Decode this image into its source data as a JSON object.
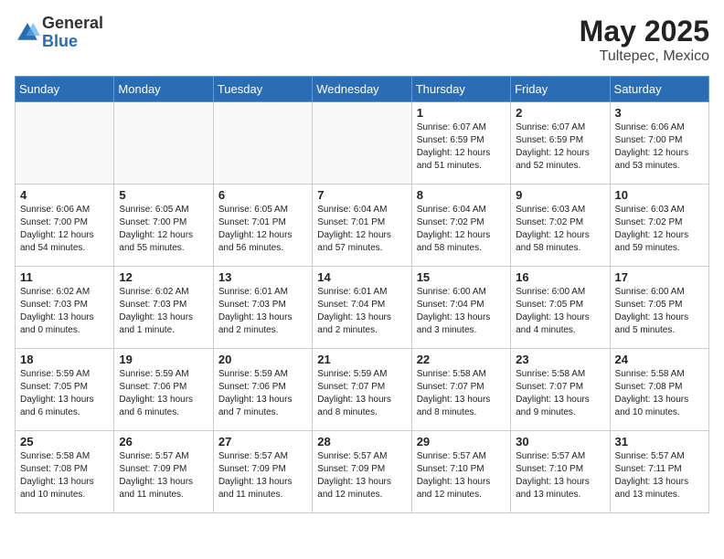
{
  "header": {
    "logo_general": "General",
    "logo_blue": "Blue",
    "month_year": "May 2025",
    "location": "Tultepec, Mexico"
  },
  "days_of_week": [
    "Sunday",
    "Monday",
    "Tuesday",
    "Wednesday",
    "Thursday",
    "Friday",
    "Saturday"
  ],
  "weeks": [
    [
      {
        "day": "",
        "info": ""
      },
      {
        "day": "",
        "info": ""
      },
      {
        "day": "",
        "info": ""
      },
      {
        "day": "",
        "info": ""
      },
      {
        "day": "1",
        "info": "Sunrise: 6:07 AM\nSunset: 6:59 PM\nDaylight: 12 hours\nand 51 minutes."
      },
      {
        "day": "2",
        "info": "Sunrise: 6:07 AM\nSunset: 6:59 PM\nDaylight: 12 hours\nand 52 minutes."
      },
      {
        "day": "3",
        "info": "Sunrise: 6:06 AM\nSunset: 7:00 PM\nDaylight: 12 hours\nand 53 minutes."
      }
    ],
    [
      {
        "day": "4",
        "info": "Sunrise: 6:06 AM\nSunset: 7:00 PM\nDaylight: 12 hours\nand 54 minutes."
      },
      {
        "day": "5",
        "info": "Sunrise: 6:05 AM\nSunset: 7:00 PM\nDaylight: 12 hours\nand 55 minutes."
      },
      {
        "day": "6",
        "info": "Sunrise: 6:05 AM\nSunset: 7:01 PM\nDaylight: 12 hours\nand 56 minutes."
      },
      {
        "day": "7",
        "info": "Sunrise: 6:04 AM\nSunset: 7:01 PM\nDaylight: 12 hours\nand 57 minutes."
      },
      {
        "day": "8",
        "info": "Sunrise: 6:04 AM\nSunset: 7:02 PM\nDaylight: 12 hours\nand 58 minutes."
      },
      {
        "day": "9",
        "info": "Sunrise: 6:03 AM\nSunset: 7:02 PM\nDaylight: 12 hours\nand 58 minutes."
      },
      {
        "day": "10",
        "info": "Sunrise: 6:03 AM\nSunset: 7:02 PM\nDaylight: 12 hours\nand 59 minutes."
      }
    ],
    [
      {
        "day": "11",
        "info": "Sunrise: 6:02 AM\nSunset: 7:03 PM\nDaylight: 13 hours\nand 0 minutes."
      },
      {
        "day": "12",
        "info": "Sunrise: 6:02 AM\nSunset: 7:03 PM\nDaylight: 13 hours\nand 1 minute."
      },
      {
        "day": "13",
        "info": "Sunrise: 6:01 AM\nSunset: 7:03 PM\nDaylight: 13 hours\nand 2 minutes."
      },
      {
        "day": "14",
        "info": "Sunrise: 6:01 AM\nSunset: 7:04 PM\nDaylight: 13 hours\nand 2 minutes."
      },
      {
        "day": "15",
        "info": "Sunrise: 6:00 AM\nSunset: 7:04 PM\nDaylight: 13 hours\nand 3 minutes."
      },
      {
        "day": "16",
        "info": "Sunrise: 6:00 AM\nSunset: 7:05 PM\nDaylight: 13 hours\nand 4 minutes."
      },
      {
        "day": "17",
        "info": "Sunrise: 6:00 AM\nSunset: 7:05 PM\nDaylight: 13 hours\nand 5 minutes."
      }
    ],
    [
      {
        "day": "18",
        "info": "Sunrise: 5:59 AM\nSunset: 7:05 PM\nDaylight: 13 hours\nand 6 minutes."
      },
      {
        "day": "19",
        "info": "Sunrise: 5:59 AM\nSunset: 7:06 PM\nDaylight: 13 hours\nand 6 minutes."
      },
      {
        "day": "20",
        "info": "Sunrise: 5:59 AM\nSunset: 7:06 PM\nDaylight: 13 hours\nand 7 minutes."
      },
      {
        "day": "21",
        "info": "Sunrise: 5:59 AM\nSunset: 7:07 PM\nDaylight: 13 hours\nand 8 minutes."
      },
      {
        "day": "22",
        "info": "Sunrise: 5:58 AM\nSunset: 7:07 PM\nDaylight: 13 hours\nand 8 minutes."
      },
      {
        "day": "23",
        "info": "Sunrise: 5:58 AM\nSunset: 7:07 PM\nDaylight: 13 hours\nand 9 minutes."
      },
      {
        "day": "24",
        "info": "Sunrise: 5:58 AM\nSunset: 7:08 PM\nDaylight: 13 hours\nand 10 minutes."
      }
    ],
    [
      {
        "day": "25",
        "info": "Sunrise: 5:58 AM\nSunset: 7:08 PM\nDaylight: 13 hours\nand 10 minutes."
      },
      {
        "day": "26",
        "info": "Sunrise: 5:57 AM\nSunset: 7:09 PM\nDaylight: 13 hours\nand 11 minutes."
      },
      {
        "day": "27",
        "info": "Sunrise: 5:57 AM\nSunset: 7:09 PM\nDaylight: 13 hours\nand 11 minutes."
      },
      {
        "day": "28",
        "info": "Sunrise: 5:57 AM\nSunset: 7:09 PM\nDaylight: 13 hours\nand 12 minutes."
      },
      {
        "day": "29",
        "info": "Sunrise: 5:57 AM\nSunset: 7:10 PM\nDaylight: 13 hours\nand 12 minutes."
      },
      {
        "day": "30",
        "info": "Sunrise: 5:57 AM\nSunset: 7:10 PM\nDaylight: 13 hours\nand 13 minutes."
      },
      {
        "day": "31",
        "info": "Sunrise: 5:57 AM\nSunset: 7:11 PM\nDaylight: 13 hours\nand 13 minutes."
      }
    ]
  ]
}
